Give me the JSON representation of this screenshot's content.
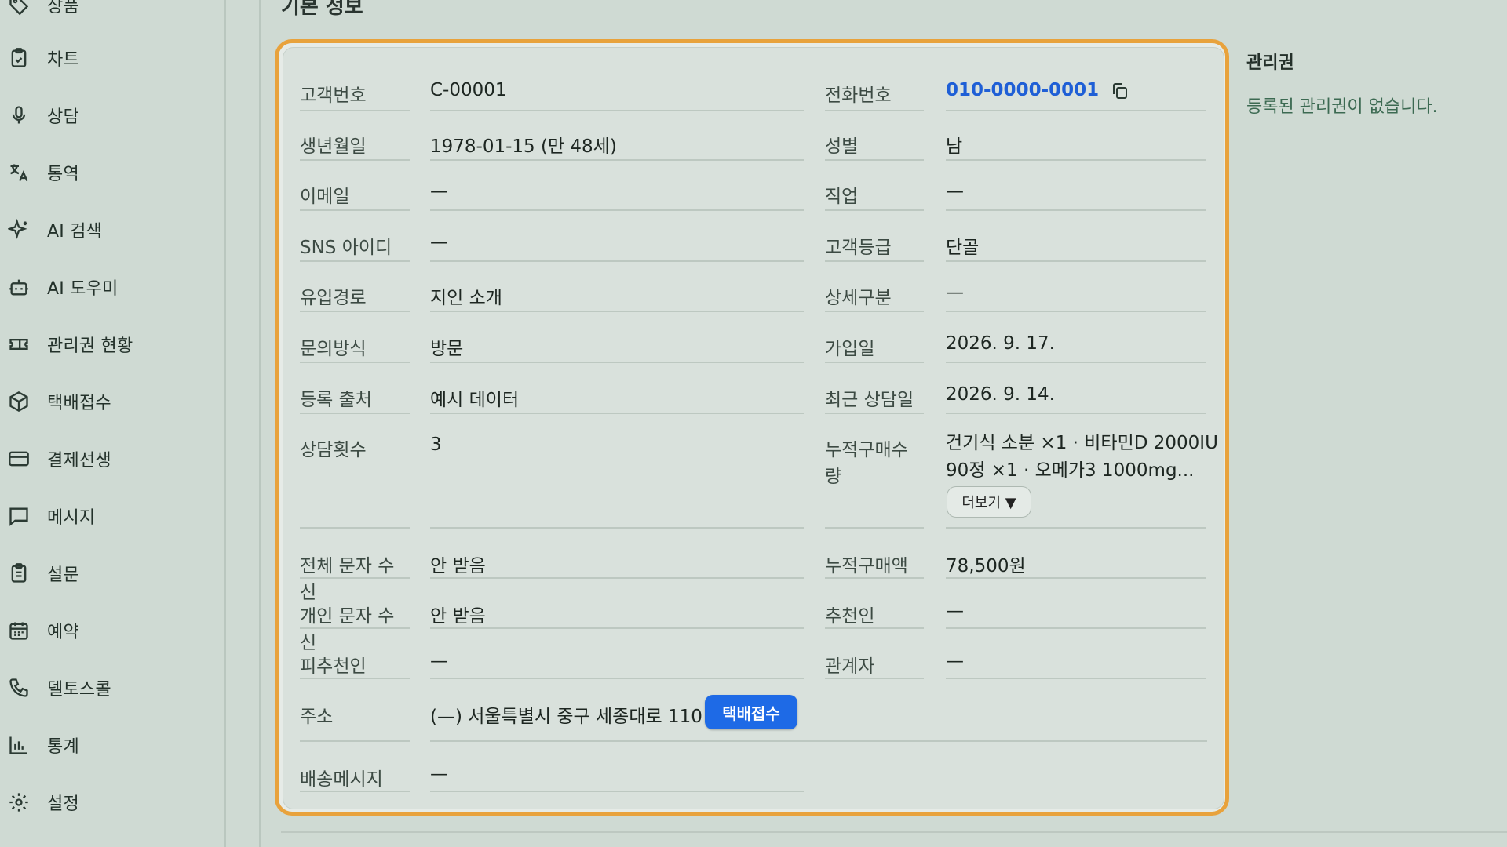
{
  "sidebar": {
    "items": [
      {
        "label": "상품",
        "icon": "tag-icon"
      },
      {
        "label": "차트",
        "icon": "chart-clipboard-icon"
      },
      {
        "label": "상담",
        "icon": "microphone-icon"
      },
      {
        "label": "통역",
        "icon": "translate-icon"
      },
      {
        "label": "AI 검색",
        "icon": "sparkles-icon"
      },
      {
        "label": "AI 도우미",
        "icon": "bot-icon"
      },
      {
        "label": "관리권 현황",
        "icon": "ticket-icon"
      },
      {
        "label": "택배접수",
        "icon": "package-icon"
      },
      {
        "label": "결제선생",
        "icon": "credit-card-icon"
      },
      {
        "label": "메시지",
        "icon": "message-square-icon"
      },
      {
        "label": "설문",
        "icon": "clipboard-list-icon"
      },
      {
        "label": "예약",
        "icon": "calendar-icon"
      },
      {
        "label": "델토스콜",
        "icon": "phone-icon"
      },
      {
        "label": "통계",
        "icon": "bar-chart-icon"
      },
      {
        "label": "설정",
        "icon": "gear-icon"
      }
    ]
  },
  "section_title": "기본 정보",
  "info": {
    "customer_no": {
      "label": "고객번호",
      "value": "C-00001"
    },
    "phone": {
      "label": "전화번호",
      "value": "010-0000-0001"
    },
    "birth": {
      "label": "생년월일",
      "value": "1978-01-15 (만 48세)"
    },
    "gender": {
      "label": "성별",
      "value": "남"
    },
    "email": {
      "label": "이메일",
      "value": "—"
    },
    "job": {
      "label": "직업",
      "value": "—"
    },
    "sns": {
      "label": "SNS 아이디",
      "value": "—"
    },
    "grade": {
      "label": "고객등급",
      "value": "단골"
    },
    "inflow": {
      "label": "유입경로",
      "value": "지인 소개"
    },
    "detail": {
      "label": "상세구분",
      "value": "—"
    },
    "inquiry": {
      "label": "문의방식",
      "value": "방문"
    },
    "joined": {
      "label": "가입일",
      "value": "2026. 9. 17."
    },
    "source": {
      "label": "등록 출처",
      "value": "예시 데이터"
    },
    "recent": {
      "label": "최근 상담일",
      "value": "2026. 9. 14."
    },
    "consult_count": {
      "label": "상담횟수",
      "value": "3"
    },
    "cumulative_qty": {
      "label": "누적구매수량",
      "value_line1": "건기식 소분 ×1 · 비타민D 2000IU",
      "value_line2": "90정 ×1 · 오메가3 1000mg...",
      "more_label": "더보기 ▼"
    },
    "sms_all": {
      "label": "전체 문자 수신",
      "value": "안 받음"
    },
    "cumulative_amount": {
      "label": "누적구매액",
      "value": "78,500원"
    },
    "sms_personal": {
      "label": "개인 문자 수신",
      "value": "안 받음"
    },
    "referrer": {
      "label": "추천인",
      "value": "—"
    },
    "referred": {
      "label": "피추천인",
      "value": "—"
    },
    "related": {
      "label": "관계자",
      "value": "—"
    },
    "address": {
      "label": "주소",
      "value": "(—) 서울특별시 중구 세종대로 110",
      "ship_button": "택배접수"
    },
    "delivery_msg": {
      "label": "배송메시지",
      "value": "—"
    }
  },
  "side_panel": {
    "title": "관리권",
    "empty": "등록된 관리권이 없습니다."
  },
  "colors": {
    "accent_border": "#e8a23c",
    "phone_link": "#1f5fd6",
    "primary_button": "#1e6ae6"
  }
}
